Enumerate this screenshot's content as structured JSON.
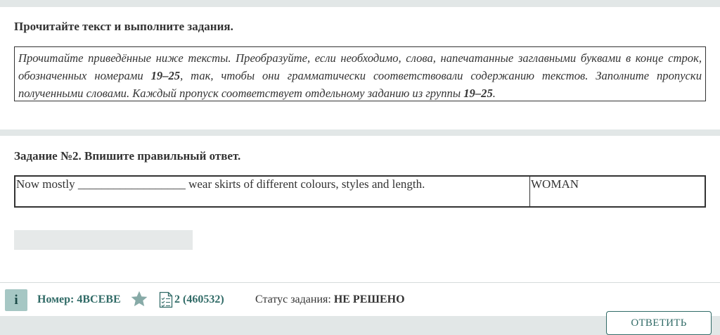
{
  "section1": {
    "heading": "Прочитайте текст и выполните задания.",
    "instr_part1": "Прочитайте приведённые ниже тексты. Преобразуйте, если необходимо, слова, напечатанные  заглавными буквами в конце строк, обозначенных номерами ",
    "instr_range1": "19–25",
    "instr_part2": ", так, чтобы они грамматически соответствовали содержанию текстов. Заполните пропуски полученными словами. Каждый пропуск соответствует отдельному заданию из группы ",
    "instr_range2": "19–25",
    "instr_part3": "."
  },
  "section2": {
    "heading": "Задание №2. Впишите правильный ответ.",
    "sentence": "Now mostly __________________ wear skirts of different colours, styles and length.",
    "keyword": "WOMAN",
    "answer_value": ""
  },
  "footer": {
    "info_icon": "i",
    "number_label": "Номер: 4BCEBE",
    "star_icon": "star-icon",
    "task_icon": "checklist-icon",
    "task_link": "2 (460532)",
    "status_label": "Статус задания: ",
    "status_value": "НЕ РЕШЕНО"
  },
  "answer_button": "ОТВЕТИТЬ",
  "colors": {
    "accent": "#316b67",
    "info_bg": "#a6c7c4",
    "page_bg": "#e2e7e7"
  }
}
